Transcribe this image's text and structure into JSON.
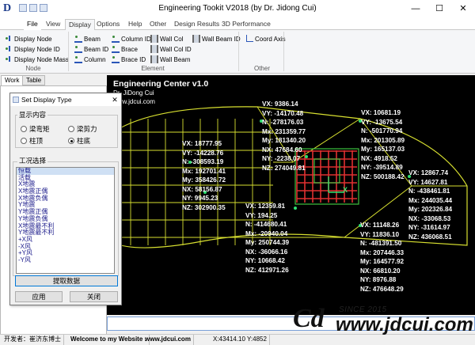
{
  "window": {
    "title": "Engineering Tookit V2018 (by Dr. Jidong Cui)",
    "logo_letter": "D",
    "minimize": "—",
    "maximize": "☐",
    "close": "✕"
  },
  "tabs": [
    "File",
    "View",
    "Display",
    "Options",
    "Help",
    "Other",
    "Design Results",
    "3D Performance"
  ],
  "active_tab": "Display",
  "ribbon": {
    "node_group": {
      "label": "Node",
      "buttons": [
        "Display Node",
        "Display Node ID",
        "Display Node Mass"
      ]
    },
    "element_group": {
      "label": "Element",
      "buttons": [
        "Beam",
        "Beam ID",
        "Column",
        "Column ID",
        "Brace",
        "Brace ID",
        "Wall Col",
        "Wall Col ID",
        "Wall Beam",
        "Wall Beam ID"
      ]
    },
    "other_group": {
      "label": "Other",
      "buttons": [
        "Coord Axis"
      ]
    }
  },
  "left_tabs": [
    "Work",
    "Table"
  ],
  "dialog": {
    "title": "Set Display Type",
    "close": "✕",
    "content_legend": "显示内容",
    "options": [
      {
        "label": "梁弯矩",
        "checked": false
      },
      {
        "label": "梁剪力",
        "checked": false
      },
      {
        "label": "柱顶",
        "checked": false
      },
      {
        "label": "柱底",
        "checked": true
      }
    ],
    "loadcase_legend": "工况选择",
    "loadcases": [
      "恒载",
      "活载",
      "X地震",
      "X地震正偶",
      "X地震负偶",
      "Y地震",
      "Y地震正偶",
      "Y地震负偶",
      "X地震最不利",
      "Y地震最不利",
      "+X风",
      "-X风",
      "+Y风",
      "-Y风"
    ],
    "selected_loadcase": "恒载",
    "extract_button": "提取数据",
    "apply_button": "应用",
    "close_button": "关闭"
  },
  "canvas": {
    "title": "Engineering Center v1.0",
    "author": "Dr. JiDong Cui",
    "site": "www.jdcui.com",
    "axis_label": "X",
    "labels": [
      {
        "lines": [
          "VX: 9386.14",
          "VY: -14170.48",
          "N: -278176.03",
          "Mx: 231359.77",
          "My: 181340.20",
          "NX: 47684.60",
          "NY: -2238.07",
          "NZ: 274049.81"
        ]
      },
      {
        "lines": [
          "VX: 10681.19",
          "VY: -13675.54",
          "N: -501770.94",
          "Mx: 201305.89",
          "My: 165137.03",
          "NX: 4918.52",
          "NY: -39514.89",
          "NZ: 500188.42"
        ]
      },
      {
        "lines": [
          "VX: 18777.95",
          "VY: -14228.76",
          "N: -308593.19",
          "Mx: 192701.41",
          "My: 358426.72",
          "NX: 58156.87",
          "NY: 9945.23",
          "NZ: 302900.35"
        ]
      },
      {
        "lines": [
          "VX: 12867.74",
          "VY: 14627.81",
          "N: -438461.81",
          "Mx: 244035.44",
          "My: 202326.84",
          "NX: -33068.53",
          "NY: -31614.97",
          "NZ: 436068.51"
        ]
      },
      {
        "lines": [
          "VX: 12359.81",
          "VY: 194.25",
          "N: -414680.41",
          "Mx: -20940.04",
          "My: 250744.39",
          "NX: -36066.16",
          "NY: 10668.42",
          "NZ: 412971.26"
        ]
      },
      {
        "lines": [
          "VX: 11148.26",
          "VY: 11836.10",
          "N: -481391.50",
          "Mx: 207446.33",
          "My: 164577.92",
          "NX: 66810.20",
          "NY: 8976.88",
          "NZ: 476648.29"
        ]
      }
    ]
  },
  "statusbar": {
    "developer": "开发者：崔济东博士",
    "welcome": "Welcome to my Website :",
    "website": "www.jdcui.com",
    "coords": "X:43414.10 Y:4852"
  },
  "watermark": {
    "mark": "Cd",
    "since": "SINCE 2015",
    "url": "www.jdcui.com"
  },
  "colors": {
    "canvas_bg": "#000000",
    "grid": "#d8e030",
    "core_red": "#e03030",
    "core_green": "#40c040",
    "node_green": "#30e070"
  }
}
